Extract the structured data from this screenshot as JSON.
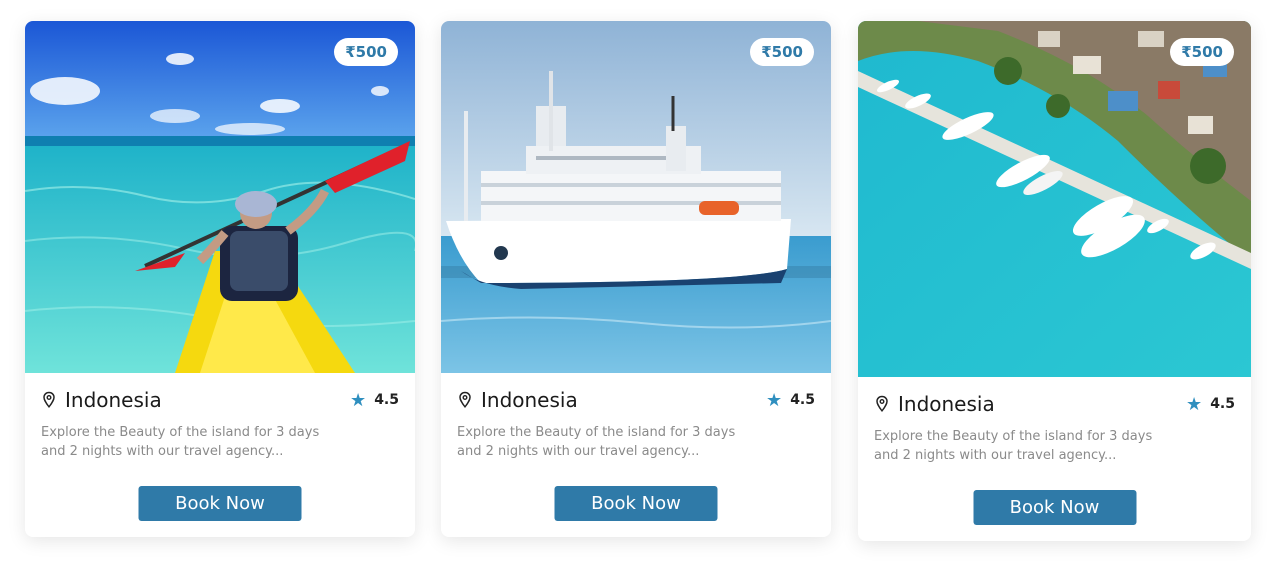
{
  "cards": [
    {
      "price": "₹500",
      "location": "Indonesia",
      "rating": "4.5",
      "description": "Explore the Beauty of the island for 3 days and 2 nights with our travel agency...",
      "button_label": "Book Now",
      "image": "kayak-turquoise-sea"
    },
    {
      "price": "₹500",
      "location": "Indonesia",
      "rating": "4.5",
      "description": "Explore the Beauty of the island for 3 days and 2 nights with our travel agency...",
      "button_label": "Book Now",
      "image": "white-ship-harbor"
    },
    {
      "price": "₹500",
      "location": "Indonesia",
      "rating": "4.5",
      "description": "Explore the Beauty of the island for 3 days and 2 nights with our travel agency...",
      "button_label": "Book Now",
      "image": "aerial-marina-island"
    }
  ],
  "colors": {
    "accent": "#2f7aa8",
    "star": "#2f8fbf",
    "muted_text": "#8a8a8a"
  },
  "icons": {
    "location": "map-pin-icon",
    "rating": "star-icon"
  }
}
